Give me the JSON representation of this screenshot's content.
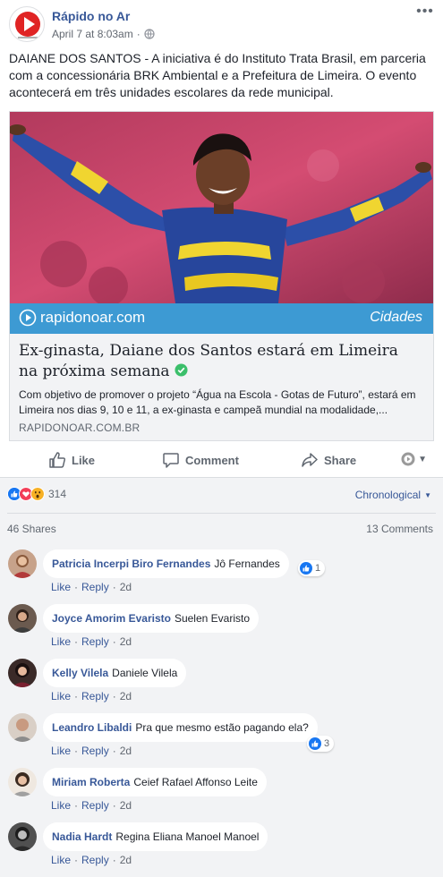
{
  "post": {
    "page_name": "Rápido no Ar",
    "timestamp": "April 7 at 8:03am",
    "separator": "·",
    "body": "DAIANE DOS SANTOS - A iniciativa é do Instituto Trata Brasil, em parceria com a concessionária BRK Ambiental e a Prefeitura de Limeira. O evento acontecerá em três unidades escolares da rede municipal."
  },
  "link_card": {
    "brand": "rapidonoar.com",
    "section_tag": "Cidades",
    "title": "Ex-ginasta, Daiane dos Santos estará em Limeira na próxima semana",
    "description": "Com objetivo de promover o projeto “Água na Escola - Gotas de Futuro”, estará em Limeira nos dias 9, 10 e 11, a ex-ginasta e campeã mundial na modalidade,...",
    "domain": "RAPIDONOAR.COM.BR"
  },
  "actions": {
    "like": "Like",
    "comment": "Comment",
    "share": "Share"
  },
  "stats": {
    "reaction_count": "314",
    "sort_label": "Chronological",
    "shares": "46 Shares",
    "comments": "13 Comments"
  },
  "colors": {
    "link_blue": "#385898",
    "brand_blue": "#3d9ad3",
    "like_blue": "#1877f2",
    "love_red": "#f33e58",
    "wow_yellow": "#f7b125",
    "verified_green": "#3bbf6b"
  },
  "comments": [
    {
      "author": "Patricia Incerpi Biro Fernandes",
      "text": "Jô Fernandes",
      "like": "Like",
      "reply": "Reply",
      "time": "2d",
      "reactions": "1"
    },
    {
      "author": "Joyce Amorim Evaristo",
      "text": "Suelen Evaristo",
      "like": "Like",
      "reply": "Reply",
      "time": "2d"
    },
    {
      "author": "Kelly Vilela",
      "text": "Daniele Vilela",
      "like": "Like",
      "reply": "Reply",
      "time": "2d"
    },
    {
      "author": "Leandro Libaldi",
      "text": "Pra que mesmo estão pagando ela?",
      "like": "Like",
      "reply": "Reply",
      "time": "2d",
      "reactions": "3"
    },
    {
      "author": "Miriam Roberta",
      "text": "Ceief Rafael Affonso Leite",
      "like": "Like",
      "reply": "Reply",
      "time": "2d"
    },
    {
      "author": "Nadia Hardt",
      "text": "Regina Eliana Manoel Manoel",
      "like": "Like",
      "reply": "Reply",
      "time": "2d"
    }
  ]
}
